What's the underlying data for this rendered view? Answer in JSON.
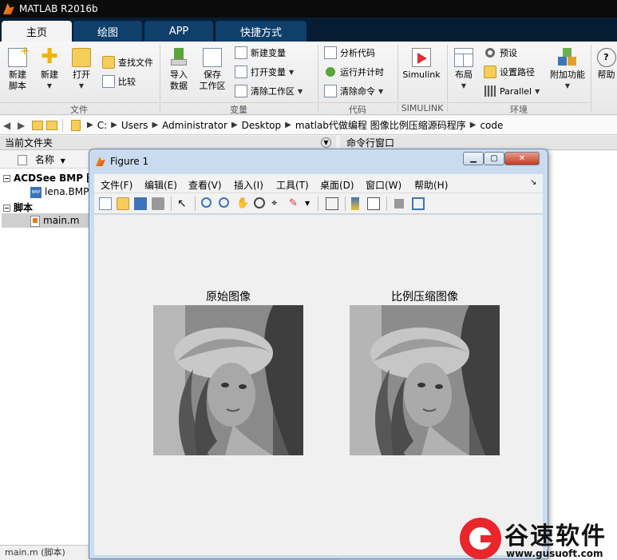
{
  "app": {
    "title": "MATLAB R2016b"
  },
  "tabs": [
    {
      "label": "主页"
    },
    {
      "label": "绘图"
    },
    {
      "label": "APP"
    },
    {
      "label": "快捷方式"
    }
  ],
  "ribbon": {
    "file": {
      "new_script": "新建\n脚本",
      "new": "新建",
      "open": "打开",
      "find_files": "查找文件",
      "compare": "比较",
      "group": "文件"
    },
    "variable": {
      "import": "导入\n数据",
      "save_ws": "保存\n工作区",
      "new_var": "新建变量",
      "open_var": "打开变量",
      "clear_ws": "清除工作区",
      "group": "变量"
    },
    "code": {
      "analyze": "分析代码",
      "run_time": "运行并计时",
      "clear_cmd": "清除命令",
      "group": "代码"
    },
    "simulink": {
      "label": "Simulink",
      "group": "SIMULINK"
    },
    "env": {
      "layout": "布局",
      "prefs": "预设",
      "set_path": "设置路径",
      "parallel": "Parallel",
      "addons": "附加功能",
      "group": "环境"
    },
    "help": {
      "label": "帮助"
    }
  },
  "address": {
    "crumbs": [
      "C:",
      "Users",
      "Administrator",
      "Desktop",
      "matlab代做编程 图像比例压缩源码程序",
      "code"
    ]
  },
  "current_folder": {
    "title": "当前文件夹",
    "column_name": "名称",
    "groups": [
      {
        "label": "ACDSee BMP 图",
        "items": [
          "lena.BMP"
        ]
      },
      {
        "label": "脚本",
        "items": [
          "main.m"
        ]
      }
    ],
    "status": "main.m  (脚本)"
  },
  "command_window": {
    "title": "命令行窗口"
  },
  "figure": {
    "title": "Figure 1",
    "menu": [
      "文件(F)",
      "编辑(E)",
      "查看(V)",
      "插入(I)",
      "工具(T)",
      "桌面(D)",
      "窗口(W)",
      "帮助(H)"
    ],
    "images": [
      {
        "title": "原始图像"
      },
      {
        "title": "比例压缩图像"
      }
    ]
  },
  "watermark": {
    "brand": "谷速软件",
    "url": "www.gusuoft.com"
  },
  "colors": {
    "tab_bar": "#061d34",
    "tab": "#0f3f6b",
    "brand_red": "#e8262b"
  }
}
